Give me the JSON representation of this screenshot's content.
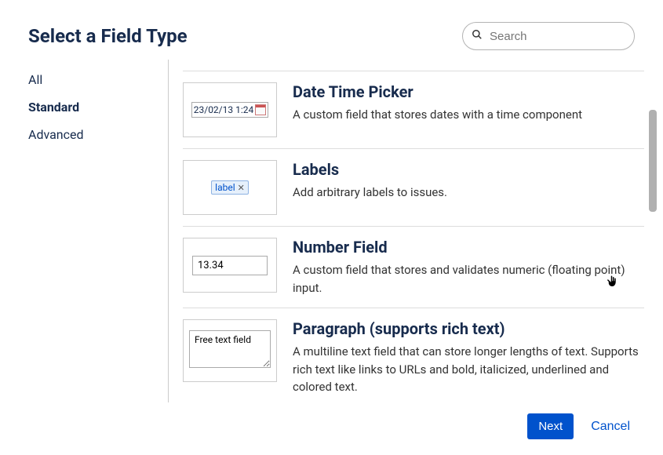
{
  "dialog": {
    "title": "Select a Field Type",
    "search_placeholder": "Search"
  },
  "sidebar": {
    "items": [
      "All",
      "Standard",
      "Advanced"
    ],
    "active_index": 1
  },
  "fields": [
    {
      "title": "Date Time Picker",
      "description": "A custom field that stores dates with a time component",
      "preview": {
        "type": "datetime",
        "value": "23/02/13 1:24"
      }
    },
    {
      "title": "Labels",
      "description": "Add arbitrary labels to issues.",
      "preview": {
        "type": "label",
        "value": "label"
      }
    },
    {
      "title": "Number Field",
      "description": "A custom field that stores and validates numeric (floating point) input.",
      "preview": {
        "type": "number",
        "value": "13.34"
      }
    },
    {
      "title": "Paragraph (supports rich text)",
      "description": "A multiline text field that can store longer lengths of text. Supports rich text like links to URLs and bold, italicized, underlined and colored text.",
      "preview": {
        "type": "paragraph",
        "value": "Free text field"
      }
    }
  ],
  "footer": {
    "next_label": "Next",
    "cancel_label": "Cancel"
  }
}
